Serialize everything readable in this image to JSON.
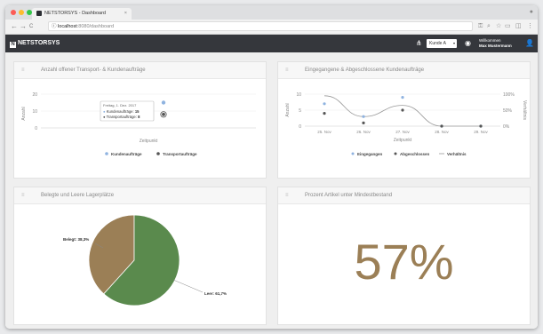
{
  "browser": {
    "tab_title": "NETSTORSYS - Dashboard",
    "url_host": "localhost",
    "url_path": ":8080/dashboard",
    "tab_close": "×",
    "nav": {
      "back": "←",
      "forward": "→",
      "reload": "C",
      "info": "ⓘ"
    },
    "toolbar_icons": [
      "key-icon",
      "search-icon",
      "star-icon",
      "extension-icon",
      "tab-icon",
      "menu-icon"
    ]
  },
  "appbar": {
    "logo": "NETSTORSYS",
    "logo_mark": "N",
    "customer_select": "Kunde A",
    "welcome": "Willkommen",
    "user_name": "Max Mustermann"
  },
  "cards": {
    "transport": {
      "title": "Anzahl offener Transport- & Kundenaufträge",
      "chart": {
        "ylabel": "Anzahl",
        "xlabel": "Zeitpunkt",
        "yticks": [
          "20",
          "10",
          "0"
        ],
        "tooltip": {
          "date": "Freitag, 1. Dez. 2017",
          "row1_label": "Kundenaufträge:",
          "row1_value": "15",
          "row2_label": "Transportaufträge:",
          "row2_value": "8"
        },
        "legend": [
          "Kundenaufträge",
          "Transportaufträge"
        ]
      }
    },
    "orders": {
      "title": "Eingegangene & Abgeschlossene Kundenaufträge",
      "chart": {
        "ylabel": "Anzahl",
        "y2label": "Verhältnis",
        "xlabel": "Zeitpunkt",
        "yticks": [
          "10",
          "5",
          "0"
        ],
        "y2ticks": [
          "100%",
          "50%",
          "0%"
        ],
        "xticks": [
          "25. Nov",
          "26. Nov",
          "27. Nov",
          "28. Nov",
          "29. Nov"
        ],
        "legend": [
          "Eingegangen",
          "Abgeschlossen",
          "Verhältnis"
        ]
      }
    },
    "storage": {
      "title": "Belegte und Leere Lagerplätze",
      "pie_labels": {
        "occupied": "Belegt: 38,3%",
        "empty": "Leer: 61,7%"
      }
    },
    "percent": {
      "title": "Prozent Artikel unter Mindestbestand",
      "value": "57%"
    }
  },
  "colors": {
    "window_red": "#fc5c56",
    "window_yellow": "#fdbc2e",
    "window_green": "#33c748",
    "appbar": "#35373c",
    "series_blue": "#8fb3e0",
    "series_dark": "#555555",
    "pie_green": "#5a8a4d",
    "pie_brown": "#9b7f56",
    "big_number": "#9b7f56"
  },
  "chart_data": [
    {
      "type": "line",
      "title": "Anzahl offener Transport- & Kundenaufträge",
      "xlabel": "Zeitpunkt",
      "ylabel": "Anzahl",
      "ylim": [
        0,
        20
      ],
      "x": [
        "Freitag, 1. Dez. 2017"
      ],
      "series": [
        {
          "name": "Kundenaufträge",
          "values": [
            15
          ]
        },
        {
          "name": "Transportaufträge",
          "values": [
            8
          ]
        }
      ],
      "legend": "bottom"
    },
    {
      "type": "line",
      "title": "Eingegangene & Abgeschlossene Kundenaufträge",
      "xlabel": "Zeitpunkt",
      "ylabel": "Anzahl",
      "y2label": "Verhältnis",
      "ylim": [
        0,
        10
      ],
      "y2lim": [
        0,
        100
      ],
      "categories": [
        "25. Nov",
        "26. Nov",
        "27. Nov",
        "28. Nov",
        "29. Nov"
      ],
      "series": [
        {
          "name": "Eingegangen",
          "values": [
            7,
            3,
            9,
            0,
            0
          ]
        },
        {
          "name": "Abgeschlossen",
          "values": [
            4,
            1,
            5,
            0,
            0
          ]
        },
        {
          "name": "Verhältnis",
          "values": [
            95,
            30,
            65,
            0,
            0
          ],
          "axis": "right"
        }
      ],
      "legend": "bottom"
    },
    {
      "type": "pie",
      "title": "Belegte und Leere Lagerplätze",
      "labels": [
        "Belegt",
        "Leer"
      ],
      "values": [
        38.3,
        61.7
      ]
    }
  ]
}
